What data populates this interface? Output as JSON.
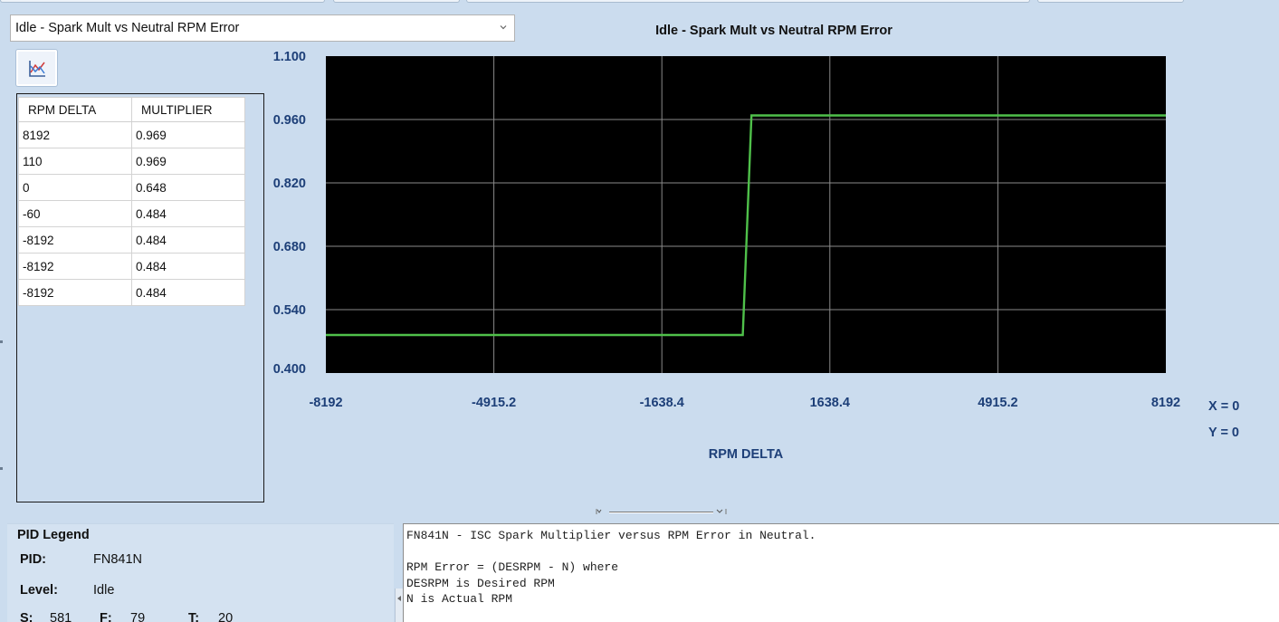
{
  "selector": {
    "value": "Idle - Spark Mult vs Neutral RPM Error"
  },
  "table": {
    "headers": [
      "RPM DELTA",
      "MULTIPLIER"
    ],
    "rows": [
      [
        "8192",
        "0.969"
      ],
      [
        "110",
        "0.969"
      ],
      [
        "0",
        "0.648"
      ],
      [
        "-60",
        "0.484"
      ],
      [
        "-8192",
        "0.484"
      ],
      [
        "-8192",
        "0.484"
      ],
      [
        "-8192",
        "0.484"
      ]
    ]
  },
  "chart_data": {
    "type": "line",
    "title": "Idle - Spark Mult vs Neutral RPM Error",
    "xlabel": "RPM DELTA",
    "ylabel": "",
    "xlim": [
      -8192,
      8192
    ],
    "ylim": [
      0.4,
      1.1
    ],
    "x_ticks": [
      "-8192",
      "-4915.2",
      "-1638.4",
      "1638.4",
      "4915.2",
      "8192"
    ],
    "y_ticks": [
      "1.100",
      "0.960",
      "0.820",
      "0.680",
      "0.540",
      "0.400"
    ],
    "grid": true,
    "background": "#000000",
    "line_color": "#4fc04a",
    "series": [
      {
        "x": [
          -8192,
          -60,
          110,
          8192
        ],
        "y": [
          0.484,
          0.484,
          0.969,
          0.969
        ]
      }
    ]
  },
  "readout": {
    "x": "X = 0",
    "y": "Y = 0"
  },
  "legend": {
    "title": "PID Legend",
    "pid_label": "PID:",
    "pid_value": "FN841N",
    "level_label": "Level:",
    "level_value": "Idle",
    "s_label": "S:",
    "s_value": "581",
    "f_label": "F:",
    "f_value": "79",
    "t_label": "T:",
    "t_value": "20"
  },
  "description": {
    "lines": [
      "FN841N - ISC Spark Multiplier versus RPM Error in Neutral.",
      "",
      "RPM Error = (DESRPM - N) where",
      "DESRPM is Desired RPM",
      "N is Actual RPM"
    ]
  },
  "icons": {
    "chevron": "chevron-down-icon",
    "graph": "chart-icon"
  }
}
